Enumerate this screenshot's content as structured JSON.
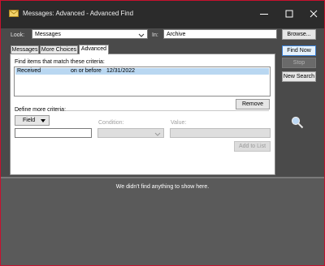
{
  "window": {
    "title": "Messages: Advanced - Advanced Find"
  },
  "look": {
    "label": "Look:",
    "value": "Messages",
    "in_label": "In:",
    "in_value": "Archive",
    "browse_label": "Browse..."
  },
  "actions": {
    "find_now": "Find Now",
    "stop": "Stop",
    "new_search": "New Search"
  },
  "tabs": [
    {
      "label": "Messages"
    },
    {
      "label": "More Choices"
    },
    {
      "label": "Advanced"
    }
  ],
  "criteria": {
    "heading": "Find items that match these criteria:",
    "rows": [
      {
        "field": "Received",
        "condition": "on or before",
        "value": "12/31/2022"
      }
    ],
    "remove_label": "Remove"
  },
  "define": {
    "heading": "Define more criteria:",
    "field_label": "Field",
    "condition_label": "Condition:",
    "value_label": "Value:",
    "add_label": "Add to List"
  },
  "status": {
    "text": "We didn't find anything to show here."
  },
  "colors": {
    "accent": "#3b7fd1",
    "selected_row": "#b9d7f1",
    "window_border": "#c8102e"
  }
}
